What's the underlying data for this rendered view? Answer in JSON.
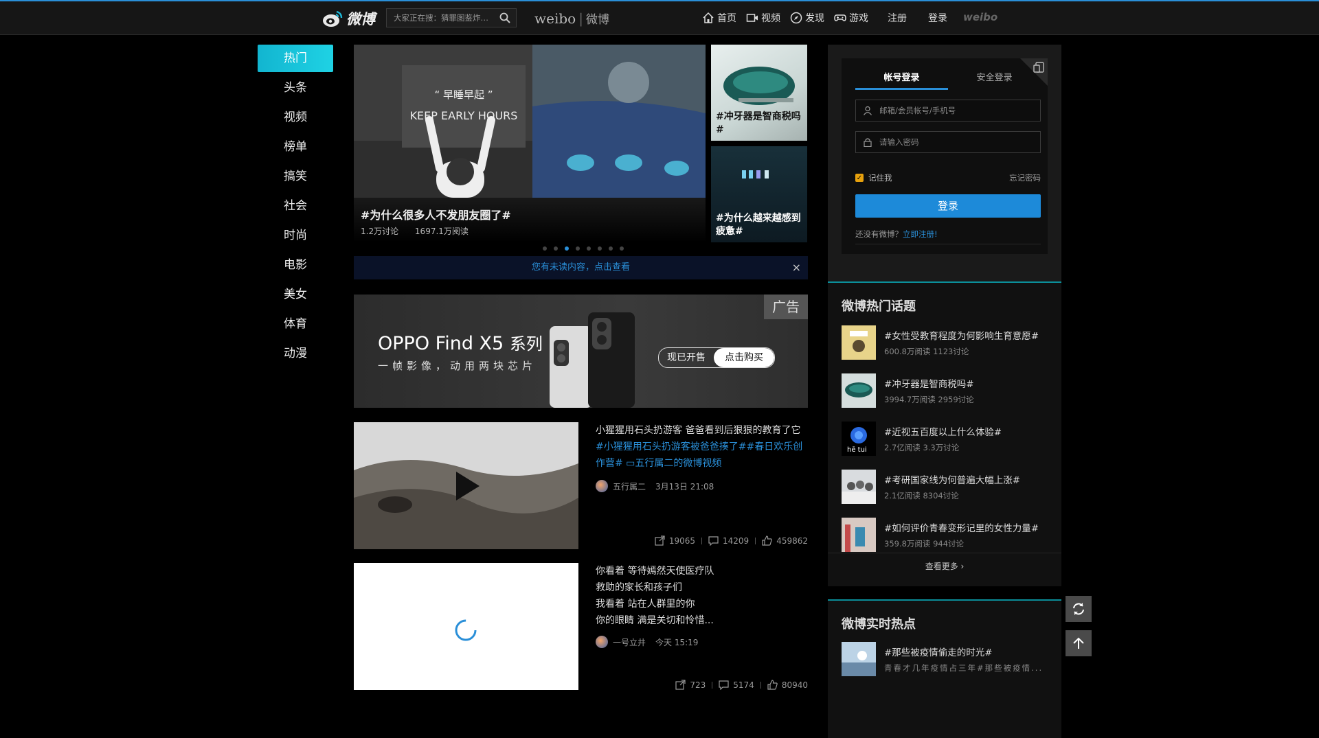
{
  "header": {
    "logo_text": "微博",
    "search_placeholder": "大家正在搜：猜罪图鉴炸…",
    "brand_en": "weibo",
    "brand_cn": "微博",
    "nav": [
      {
        "label": "首页",
        "icon": "home-icon"
      },
      {
        "label": "视频",
        "icon": "video-icon"
      },
      {
        "label": "发现",
        "icon": "compass-icon"
      },
      {
        "label": "游戏",
        "icon": "gamepad-icon"
      }
    ],
    "register": "注册",
    "login": "登录",
    "mark": "weibo"
  },
  "sidebar": {
    "items": [
      "热门",
      "头条",
      "视频",
      "榜单",
      "搞笑",
      "社会",
      "时尚",
      "电影",
      "美女",
      "体育",
      "动漫"
    ],
    "active_index": 0
  },
  "carousel": {
    "main": {
      "overlay_line1": "“ 早睡早起 ”",
      "overlay_line2": "KEEP EARLY HOURS",
      "title": "#为什么很多人不发朋友圈了#",
      "discussions": "1.2万讨论",
      "reads": "1697.1万阅读"
    },
    "side": [
      {
        "label": "#冲牙器是智商税吗#"
      },
      {
        "label": "#为什么越来越感到疲惫#"
      }
    ],
    "dots_count": 8,
    "active_dot": 2
  },
  "unread": {
    "text": "您有未读内容，点击查看",
    "close": "×"
  },
  "ad": {
    "title": "OPPO Find X5",
    "title_suffix": "系列",
    "subtitle": "一帧影像，动用两块芯片",
    "tag": "广告",
    "btn_presale": "现已开售",
    "btn_buy": "点击购买"
  },
  "feed": [
    {
      "title": "小猩猩用石头扔游客 爸爸看到后狠狠的教育了它",
      "highlight": "#小猩猩用石头扔游客被爸爸揍了##春日欢乐创作营# ▭五行属二的微博视频",
      "author": "五行属二",
      "time": "3月13日 21:08",
      "shares": "19065",
      "comments": "14209",
      "likes": "459862"
    },
    {
      "lines": [
        "你看着 等待嫣然天使医疗队",
        "救助的家长和孩子们",
        "我看着 站在人群里的你",
        "你的眼睛 满是关切和怜惜..."
      ],
      "author": "一号立井",
      "time": "今天 15:19",
      "shares": "723",
      "comments": "5174",
      "likes": "80940"
    }
  ],
  "login": {
    "tab_account": "帐号登录",
    "tab_secure": "安全登录",
    "user_placeholder": "邮箱/会员帐号/手机号",
    "pass_placeholder": "请输入密码",
    "remember": "记住我",
    "forgot": "忘记密码",
    "button": "登录",
    "no_account": "还没有微博？",
    "register_link": "立即注册!"
  },
  "topics": {
    "heading": "微博热门话题",
    "items": [
      {
        "title": "#女性受教育程度为何影响生育意愿#",
        "meta": "600.8万阅读 1123讨论"
      },
      {
        "title": "#冲牙器是智商税吗#",
        "meta": "3994.7万阅读 2959讨论"
      },
      {
        "title": "#近视五百度以上什么体验#",
        "meta": "2.7亿阅读 3.3万讨论",
        "img_text": "hē tui"
      },
      {
        "title": "#考研国家线为何普遍大幅上涨#",
        "meta": "2.1亿阅读 8304讨论"
      },
      {
        "title": "#如何评价青春变形记里的女性力量#",
        "meta": "359.8万阅读 944讨论"
      }
    ],
    "more": "查看更多 ›"
  },
  "hot": {
    "heading": "微博实时热点",
    "items": [
      {
        "title": "#那些被疫情偷走的时光#",
        "meta": "青春才几年疫情占三年#那些被疫情..."
      }
    ]
  },
  "colors": {
    "accent": "#2a8fd8",
    "active_tab": "#12b5d0",
    "topbar": "#161616"
  }
}
